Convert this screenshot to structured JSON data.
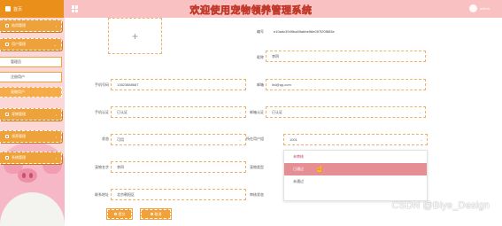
{
  "header": {
    "brand": "首页",
    "title": "欢迎使用宠物领养管理系统",
    "user": "admin"
  },
  "sidebar": {
    "items": [
      {
        "label": "结用管理"
      },
      {
        "label": "用户管理"
      },
      {
        "label": "宠物管理"
      },
      {
        "label": "领养管理"
      },
      {
        "label": "系统管理"
      }
    ],
    "subitems": [
      {
        "label": "管理员"
      },
      {
        "label": "注册用户"
      },
      {
        "label": "宠物用户"
      }
    ]
  },
  "form": {
    "id_label": "编号",
    "id_value": "e10adc3949ba59abbe56e057f20f883e",
    "name_label": "昵称",
    "name_value": "李四",
    "phone_label": "手机号码",
    "phone_value": "13823888687",
    "email_label": "邮箱",
    "email_value": "lisi@qq.com",
    "phone_cert_label": "手机认证",
    "phone_cert_value": "已认证",
    "email_cert_label": "邮箱认证",
    "email_cert_value": "已认证",
    "status_label": "状态",
    "status_value": "可用",
    "role_label": "所在用户组",
    "role_value": "1001",
    "surname_label": "宠物名字",
    "surname_value": "李四",
    "nickname_label": "宠物类型",
    "address_label": "联系地址",
    "address_value": "北京朝阳区",
    "review_label": "审核状态",
    "review_value": "未审核",
    "dropdown": [
      {
        "label": "未审核",
        "state": "head"
      },
      {
        "label": "已通过",
        "state": "hover"
      },
      {
        "label": "未通过",
        "state": ""
      }
    ],
    "submit_label": "提交",
    "cancel_label": "取消"
  },
  "watermark": "CSDN @Biye_Design",
  "colors": {
    "topbar": "#f9c1c1",
    "brand": "#e98f1a",
    "accent": "#f2a13a",
    "hover": "#e58f95"
  }
}
